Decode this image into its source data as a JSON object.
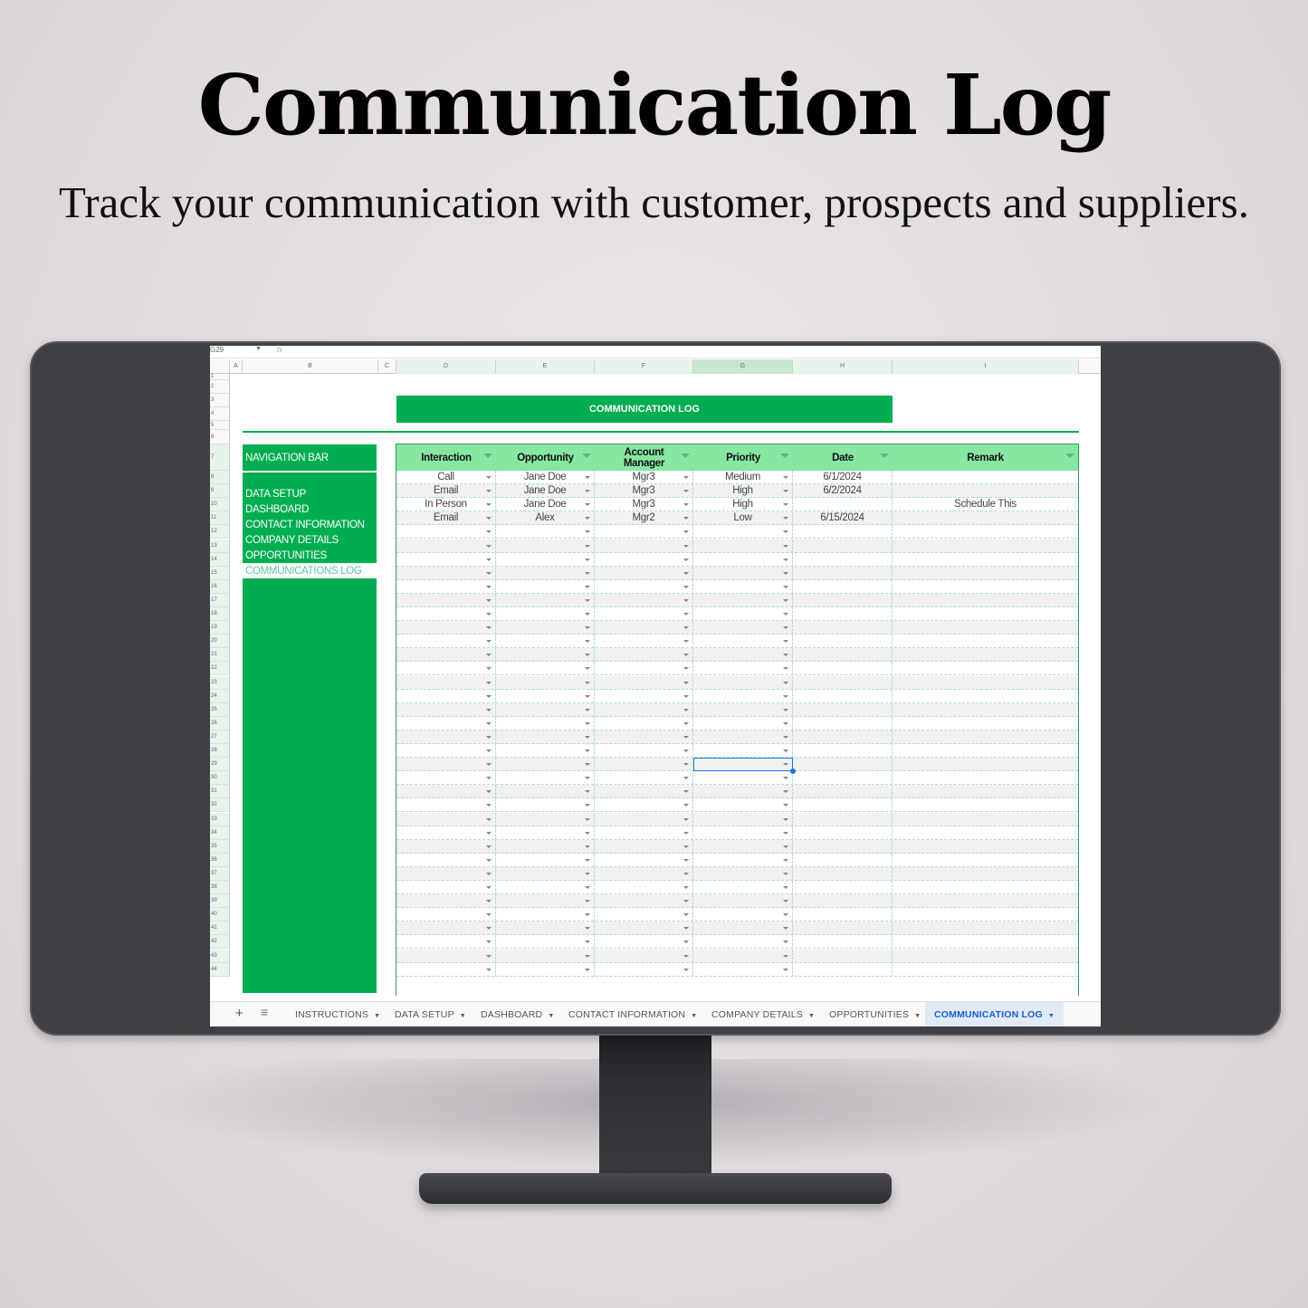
{
  "promo": {
    "title": "Communication Log",
    "subtitle": "Track your communication with customer, prospects and suppliers."
  },
  "spreadsheet": {
    "name_box": "G29",
    "fx_label": "fx",
    "columns": [
      "A",
      "B",
      "C",
      "D",
      "E",
      "F",
      "G",
      "H",
      "I"
    ],
    "active_column": "G",
    "active_row": 29,
    "row_numbers": [
      1,
      2,
      3,
      4,
      5,
      6,
      7,
      8,
      9,
      10,
      11,
      12,
      13,
      14,
      15,
      16,
      17,
      18,
      19,
      20,
      21,
      22,
      23,
      24,
      25,
      26,
      27,
      28,
      29,
      30,
      31,
      32,
      33,
      34,
      35,
      36,
      37,
      38,
      39,
      40,
      41,
      42,
      43,
      44
    ],
    "banner_title": "COMMUNICATION LOG",
    "navigation": {
      "header": "NAVIGATION BAR",
      "items": [
        {
          "label": "DATA SETUP"
        },
        {
          "label": "DASHBOARD"
        },
        {
          "label": "CONTACT INFORMATION"
        },
        {
          "label": "COMPANY DETAILS"
        },
        {
          "label": "OPPORTUNITIES"
        },
        {
          "label": "COMMUNICATIONS LOG",
          "current": true
        }
      ]
    },
    "table": {
      "headers": [
        "Interaction",
        "Opportunity",
        "Account Manager",
        "Priority",
        "Date",
        "Remark"
      ],
      "rows": [
        [
          "Call",
          "Jane Doe",
          "Mgr3",
          "Medium",
          "6/1/2024",
          ""
        ],
        [
          "Email",
          "Jane Doe",
          "Mgr3",
          "High",
          "6/2/2024",
          ""
        ],
        [
          "In Person",
          "Jane Doe",
          "Mgr3",
          "High",
          "",
          "Schedule This"
        ],
        [
          "Email",
          "Alex",
          "Mgr2",
          "Low",
          "6/15/2024",
          ""
        ]
      ],
      "empty_row_count": 33
    },
    "sheet_tabs": {
      "add_label": "+",
      "menu_label": "≡",
      "tabs": [
        {
          "label": "INSTRUCTIONS"
        },
        {
          "label": "DATA SETUP"
        },
        {
          "label": "DASHBOARD"
        },
        {
          "label": "CONTACT INFORMATION"
        },
        {
          "label": "COMPANY DETAILS"
        },
        {
          "label": "OPPORTUNITIES"
        },
        {
          "label": "COMMUNICATION LOG",
          "active": true
        }
      ]
    }
  },
  "colors": {
    "brand_green": "#00ad50",
    "header_green": "#86e6a2",
    "active_tab_blue": "#1a5fd0",
    "selection_blue": "#1a73e8"
  }
}
